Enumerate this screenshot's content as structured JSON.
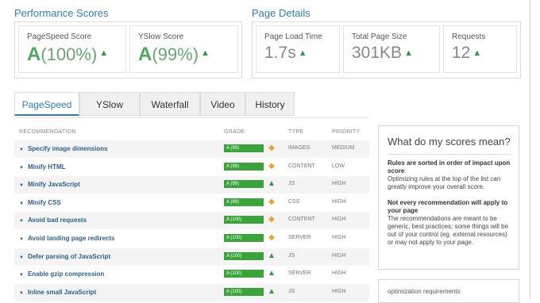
{
  "performance": {
    "title": "Performance Scores",
    "pagespeed": {
      "label": "PageSpeed Score",
      "grade": "A",
      "percent": "(100%)"
    },
    "yslow": {
      "label": "YSlow Score",
      "grade": "A",
      "percent": "(99%)"
    }
  },
  "details": {
    "title": "Page Details",
    "load_time": {
      "label": "Page Load Time",
      "value": "1.7s"
    },
    "page_size": {
      "label": "Total Page Size",
      "value": "301KB"
    },
    "requests": {
      "label": "Requests",
      "value": "12"
    }
  },
  "tabs": [
    "PageSpeed",
    "YSlow",
    "Waterfall",
    "Video",
    "History"
  ],
  "table": {
    "headers": {
      "recommendation": "RECOMMENDATION",
      "grade": "GRADE",
      "type": "TYPE",
      "priority": "PRIORITY"
    },
    "rows": [
      {
        "name": "Specify image dimensions",
        "grade": "A (99)",
        "trend": "diamond",
        "type": "IMAGES",
        "priority": "MEDIUM"
      },
      {
        "name": "Minify HTML",
        "grade": "A (99)",
        "trend": "diamond",
        "type": "CONTENT",
        "priority": "LOW"
      },
      {
        "name": "Minify JavaScript",
        "grade": "A (99)",
        "trend": "up",
        "type": "JS",
        "priority": "HIGH"
      },
      {
        "name": "Minify CSS",
        "grade": "A (99)",
        "trend": "diamond",
        "type": "CSS",
        "priority": "HIGH"
      },
      {
        "name": "Avoid bad requests",
        "grade": "A (100)",
        "trend": "diamond",
        "type": "CONTENT",
        "priority": "HIGH"
      },
      {
        "name": "Avoid landing page redirects",
        "grade": "A (100)",
        "trend": "diamond",
        "type": "SERVER",
        "priority": "HIGH"
      },
      {
        "name": "Defer parsing of JavaScript",
        "grade": "A (100)",
        "trend": "up",
        "type": "JS",
        "priority": "HIGH"
      },
      {
        "name": "Enable gzip compression",
        "grade": "A (100)",
        "trend": "up",
        "type": "SERVER",
        "priority": "HIGH"
      },
      {
        "name": "Inline small JavaScript",
        "grade": "A (100)",
        "trend": "up",
        "type": "JS",
        "priority": "HIGH"
      }
    ]
  },
  "sidebar": {
    "title": "What do my scores mean?",
    "p1_bold": "Rules are sorted in order of impact upon score",
    "p1_text": "Optimizing rules at the top of the list can greatly improve your overall score.",
    "p2_bold": "Not every recommendation will apply to your page",
    "p2_text": "The recommendations are meant to be generic, best practices; some things will be out of your control (eg. external resources) or may not apply to your page.",
    "footer_text": "optimization requirements"
  },
  "colors": {
    "accent": "#2f7db8",
    "grade_green": "#3aa33a",
    "trend_up": "#2e9b45",
    "trend_neutral": "#f0a02c"
  }
}
